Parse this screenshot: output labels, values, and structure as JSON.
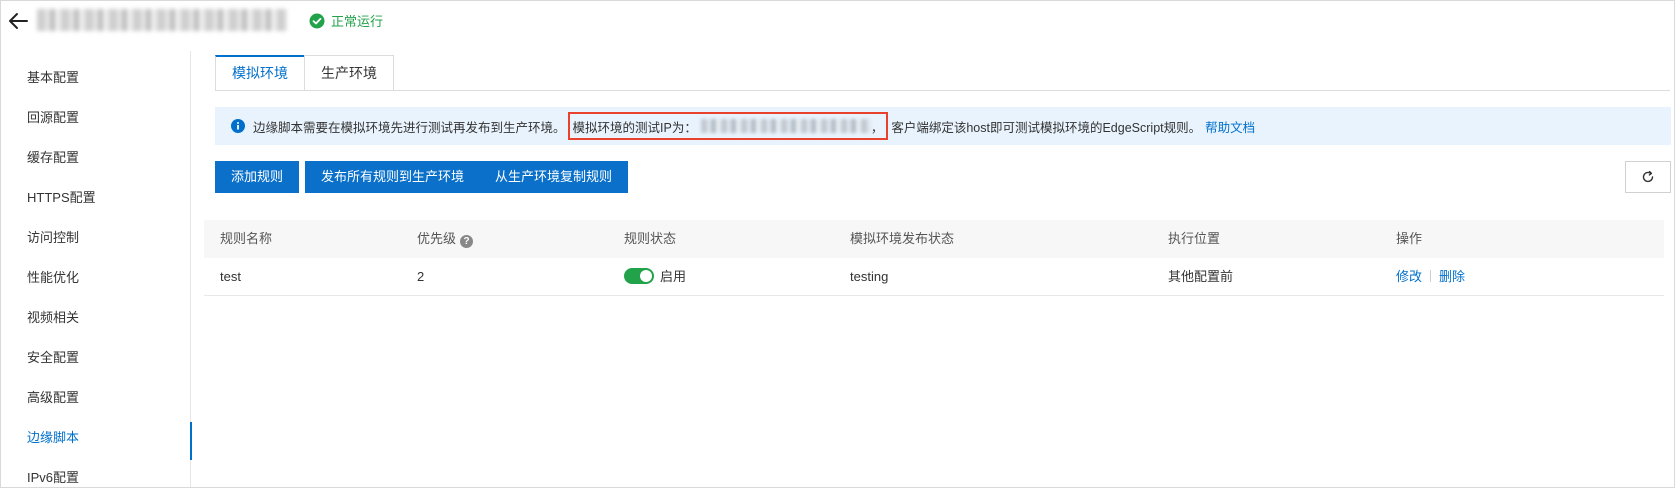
{
  "header": {
    "status_text": "正常运行",
    "status_color": "#22a24a"
  },
  "sidebar": {
    "items": [
      {
        "label": "基本配置"
      },
      {
        "label": "回源配置"
      },
      {
        "label": "缓存配置"
      },
      {
        "label": "HTTPS配置"
      },
      {
        "label": "访问控制"
      },
      {
        "label": "性能优化"
      },
      {
        "label": "视频相关"
      },
      {
        "label": "安全配置"
      },
      {
        "label": "高级配置"
      },
      {
        "label": "边缘脚本",
        "active": true
      },
      {
        "label": "IPv6配置"
      }
    ]
  },
  "tabs": [
    {
      "label": "模拟环境",
      "active": true
    },
    {
      "label": "生产环境"
    }
  ],
  "info": {
    "prefix": "边缘脚本需要在模拟环境先进行测试再发布到生产环境。",
    "ip_label": "模拟环境的测试IP为：",
    "ip_suffix": "，",
    "suffix": "客户端绑定该host即可测试模拟环境的EdgeScript规则。",
    "help_link": "帮助文档"
  },
  "toolbar": {
    "add_rule": "添加规则",
    "publish_all": "发布所有规则到生产环境",
    "copy_from_prod": "从生产环境复制规则"
  },
  "table": {
    "headers": {
      "name": "规则名称",
      "priority": "优先级",
      "status": "规则状态",
      "publish_status": "模拟环境发布状态",
      "position": "执行位置",
      "actions": "操作"
    },
    "rows": [
      {
        "name": "test",
        "priority": "2",
        "status": "启用",
        "publish_status": "testing",
        "position": "其他配置前",
        "edit": "修改",
        "delete": "删除"
      }
    ]
  },
  "colors": {
    "accent": "#0070cc",
    "button": "#0a70c9",
    "highlight_box": "#e8412c",
    "info_bg": "#e8f3fd"
  }
}
